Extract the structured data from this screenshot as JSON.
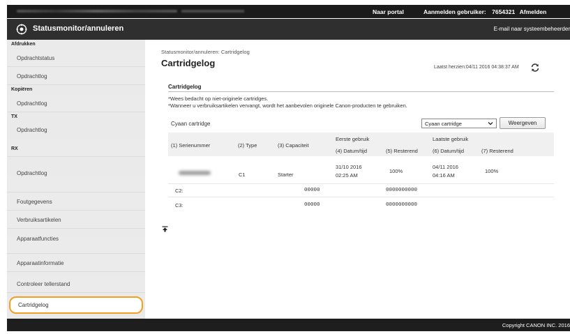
{
  "topbar": {
    "portal_link": "Naar portal",
    "login_label": "Aanmelden gebruiker:",
    "user_id": "7654321",
    "logout": "Afmelden"
  },
  "header": {
    "title": "Statusmonitor/annuleren",
    "email_link": "E-mail naar systeembeheerder"
  },
  "sidebar": {
    "cat_print": "Afdrukken",
    "item_job_status": "Opdrachtstatus",
    "item_job_log_print": "Opdrachtlog",
    "cat_copy": "Kopiëren",
    "item_job_log_copy": "Opdrachtlog",
    "cat_tx": "TX",
    "item_job_log_tx": "Opdrachtlog",
    "cat_rx": "RX",
    "item_job_log_rx": "Opdrachtlog",
    "item_errors": "Foutgegevens",
    "item_consumables": "Verbruiksartikelen",
    "item_device_functions": "Apparaatfuncties",
    "item_device_info": "Apparaatinformatie",
    "item_counter": "Controleer tellerstand",
    "item_cartridge_log": "Cartridgelog"
  },
  "main": {
    "breadcrumb": "Statusmonitor/annuleren: Cartridgelog",
    "page_title": "Cartridgelog",
    "last_updated": "Laatst herzien:04/11 2016 04:38:37 AM",
    "section_title": "Cartridgelog",
    "note1": "*Wees bedacht op niet-originele cartridges.",
    "note2": "*Wanneer u verbruiksartikelen vervangt, wordt het aanbevolen originele Canon-producten te gebruiken.",
    "cartridge_label": "Cyaan cartridge",
    "select_value": "Cyaan cartridge",
    "view_button": "Weergeven"
  },
  "table": {
    "h_serial": "(1) Serienummer",
    "h_type": "(2) Type",
    "h_capacity": "(3) Capaciteit",
    "h_first_use": "Eerste gebruik",
    "h_last_use": "Laatste gebruik",
    "h_datetime1": "(4) Datum/tijd",
    "h_remaining1": "(5) Resterend",
    "h_datetime2": "(6) Datum/tijd",
    "h_remaining2": "(7) Resterend",
    "row1": {
      "type": "C1",
      "capacity": "Starter",
      "first_date": "31/10 2016",
      "first_time": "02:25 AM",
      "first_remaining": "100%",
      "last_date": "04/11 2016",
      "last_time": "04:16 AM",
      "last_remaining": "100%"
    },
    "row2": {
      "type": "C2:",
      "capacity": "00000",
      "remaining": "0000000000"
    },
    "row3": {
      "type": "C3:",
      "capacity": "00000",
      "remaining": "0000000000"
    }
  },
  "footer": {
    "copyright": "Copyright CANON INC. 2016"
  }
}
